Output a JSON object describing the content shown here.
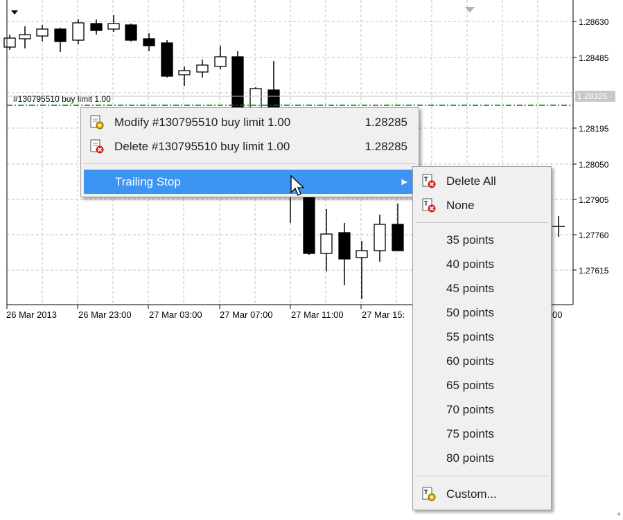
{
  "chart": {
    "price_labels": [
      "1.28630",
      "1.28485",
      "1.28195",
      "1.28050",
      "1.27905",
      "1.27760",
      "1.27615"
    ],
    "current_price": "1.28326",
    "time_labels": [
      "26 Mar 2013",
      "26 Mar 23:00",
      "27 Mar 03:00",
      "27 Mar 07:00",
      "27 Mar 11:00",
      "27 Mar 15:",
      "00"
    ],
    "order_line_label": "#130795510 buy limit 1.00",
    "colors": {
      "grid": "#c0c0c0",
      "order_line": "#008000",
      "current_price_bg": "#c8c8c8"
    }
  },
  "context_menu": {
    "items": [
      {
        "label": "Modify #130795510 buy limit 1.00",
        "value": "1.28285",
        "icon": "modify-order-icon"
      },
      {
        "label": "Delete #130795510 buy limit 1.00",
        "value": "1.28285",
        "icon": "delete-order-icon"
      },
      {
        "label": "Trailing Stop",
        "icon": "submenu-arrow-icon"
      }
    ],
    "highlight_color": "#3d95f3"
  },
  "trailing_submenu": {
    "top_items": [
      {
        "label": "Delete All",
        "icon": "trailing-delete-icon"
      },
      {
        "label": "None",
        "icon": "trailing-delete-icon"
      }
    ],
    "points": [
      "35 points",
      "40 points",
      "45 points",
      "50 points",
      "55 points",
      "60 points",
      "65 points",
      "70 points",
      "75 points",
      "80 points"
    ],
    "custom": {
      "label": "Custom...",
      "icon": "trailing-custom-icon"
    }
  }
}
